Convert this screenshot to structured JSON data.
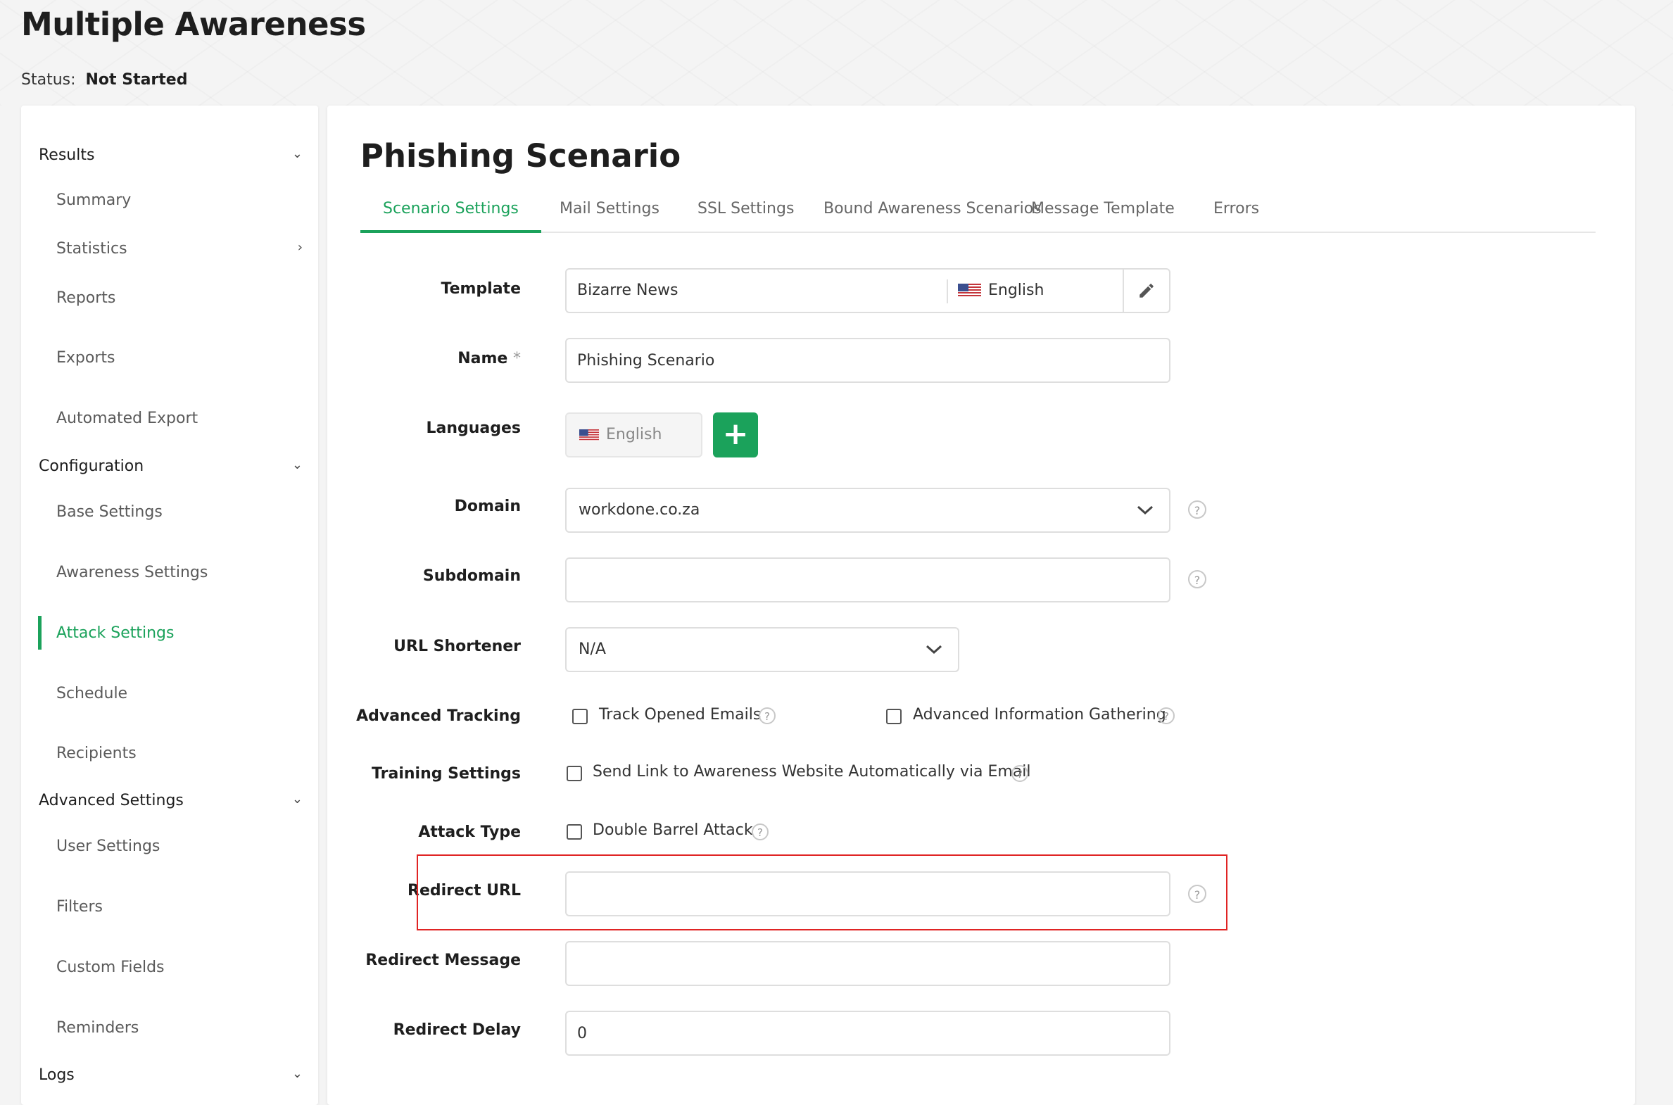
{
  "header": {
    "title": "Multiple Awareness",
    "status_label": "Status:",
    "status_value": "Not Started"
  },
  "sidebar": {
    "groups": [
      {
        "label": "Results",
        "items": [
          "Summary",
          "Statistics",
          "Reports",
          "Exports",
          "Automated Export"
        ]
      },
      {
        "label": "Configuration",
        "items": [
          "Base Settings",
          "Awareness Settings",
          "Attack Settings",
          "Schedule",
          "Recipients"
        ]
      },
      {
        "label": "Advanced Settings",
        "items": [
          "User Settings",
          "Filters",
          "Custom Fields",
          "Reminders"
        ]
      },
      {
        "label": "Logs",
        "items": []
      }
    ],
    "active_item": "Attack Settings"
  },
  "main": {
    "title": "Phishing Scenario",
    "tabs": [
      "Scenario Settings",
      "Mail Settings",
      "SSL Settings",
      "Bound Awareness Scenarios",
      "Message Template",
      "Errors"
    ],
    "active_tab": "Scenario Settings"
  },
  "form": {
    "template": {
      "label": "Template",
      "value": "Bizarre News",
      "language": "English"
    },
    "name": {
      "label": "Name",
      "required_mark": "*",
      "value": "Phishing Scenario"
    },
    "languages": {
      "label": "Languages",
      "value": "English",
      "add_symbol": "+"
    },
    "domain": {
      "label": "Domain",
      "value": "workdone.co.za"
    },
    "subdomain": {
      "label": "Subdomain",
      "value": ""
    },
    "url_shortener": {
      "label": "URL Shortener",
      "value": "N/A"
    },
    "advanced_tracking": {
      "label": "Advanced Tracking",
      "opt1": "Track Opened Emails",
      "opt2": "Advanced Information Gathering"
    },
    "training_settings": {
      "label": "Training Settings",
      "opt1": "Send Link to Awareness Website Automatically via Email"
    },
    "attack_type": {
      "label": "Attack Type",
      "opt1": "Double Barrel Attack"
    },
    "redirect_url": {
      "label": "Redirect URL",
      "value": ""
    },
    "redirect_message": {
      "label": "Redirect Message",
      "value": ""
    },
    "redirect_delay": {
      "label": "Redirect Delay",
      "value": "0"
    }
  },
  "icons": {
    "help": "?",
    "chevron_down": "⌄",
    "chevron_right": "›",
    "edit": "pencil-icon"
  },
  "colors": {
    "accent": "#1ba25b",
    "highlight": "#e02424"
  }
}
